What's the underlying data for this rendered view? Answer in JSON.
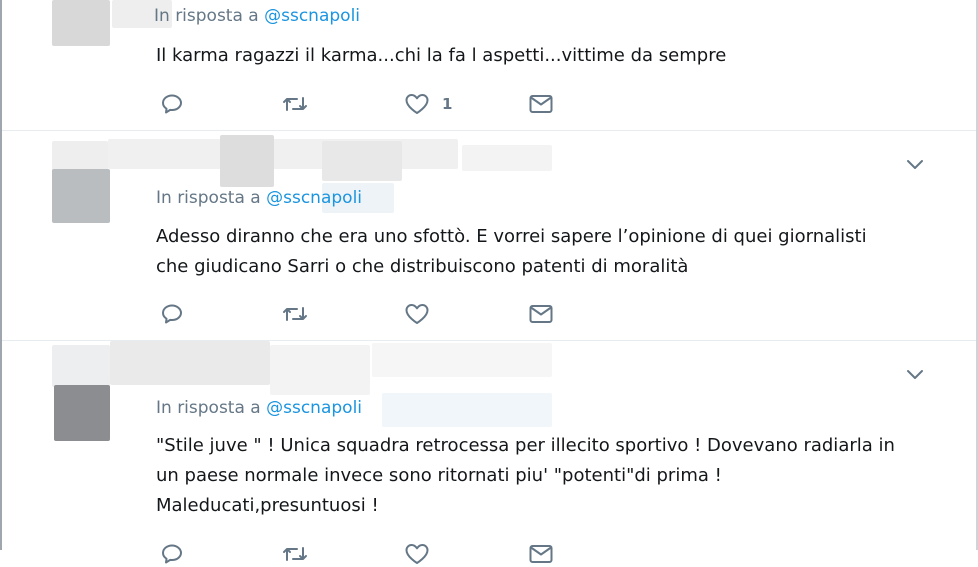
{
  "tweets": [
    {
      "reply_prefix": "In risposta a",
      "reply_handle": "@sscnapoli",
      "lines": [
        "Il karma ragazzi il karma...chi la fa l aspetti...vittime da sempre"
      ],
      "like_count": "1"
    },
    {
      "reply_prefix": "In risposta a",
      "reply_handle": "@sscnapoli",
      "lines": [
        "Adesso diranno che era uno sfottò. E vorrei sapere l’opinione di quei giornalisti",
        "che giudicano Sarri o che distribuiscono patenti di moralità"
      ]
    },
    {
      "reply_prefix": "In risposta a",
      "reply_handle": "@sscnapoli",
      "lines": [
        "\"Stile juve \" ! Unica squadra retrocessa per illecito sportivo ! Dovevano radiarla in",
        "un paese normale invece sono ritornati piu' \"potenti\"di prima !",
        "Maleducati,presuntuosi !"
      ]
    }
  ],
  "icons": {
    "reply": "reply-icon",
    "retweet": "retweet-icon",
    "like": "heart-icon",
    "dm": "envelope-icon",
    "more": "chevron-down-icon"
  },
  "colors": {
    "icon": "#657786",
    "link": "#1b95e0",
    "text": "#14171a",
    "divider": "#e6ecf0"
  }
}
